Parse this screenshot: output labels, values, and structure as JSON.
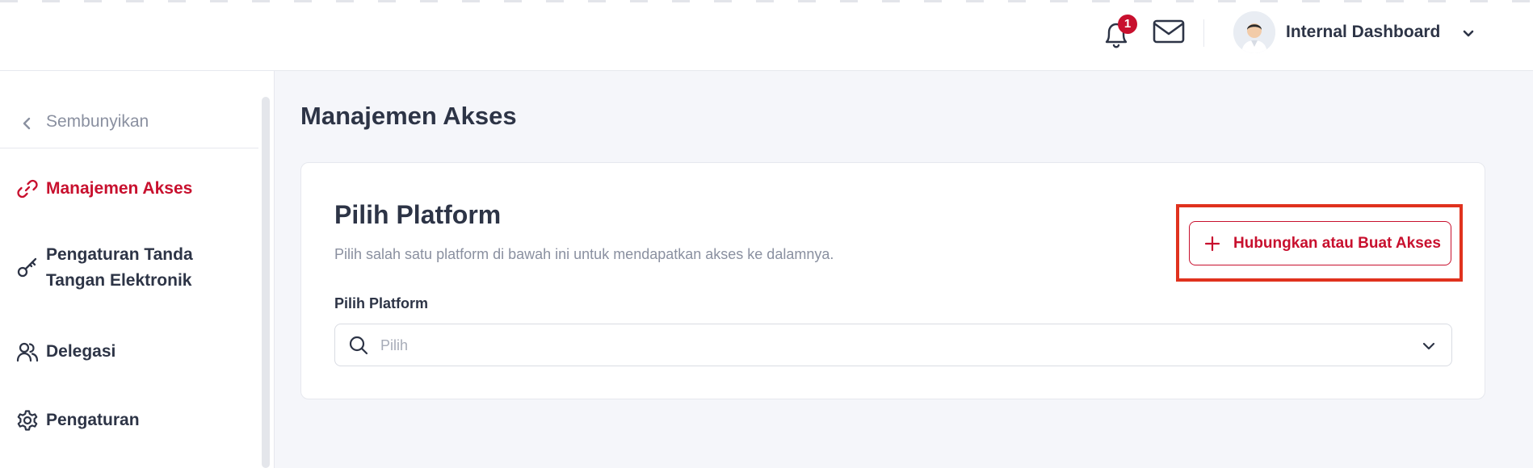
{
  "header": {
    "notification_count": "1",
    "profile_name": "Internal Dashboard",
    "icons": [
      "bell-icon",
      "mail-icon",
      "chevron-down-icon"
    ]
  },
  "sidebar": {
    "hide_label": "Sembunyikan",
    "items": [
      {
        "label": "Manajemen Akses",
        "icon": "link-icon",
        "active": true
      },
      {
        "label_line1": "Pengaturan Tanda",
        "label_line2": "Tangan Elektronik",
        "icon": "key-icon",
        "active": false
      },
      {
        "label": "Delegasi",
        "icon": "users-icon",
        "active": false
      },
      {
        "label": "Pengaturan",
        "icon": "gear-icon",
        "active": false
      }
    ]
  },
  "main": {
    "page_title": "Manajemen Akses",
    "card": {
      "title": "Pilih Platform",
      "subtitle": "Pilih salah satu platform di bawah ini untuk mendapatkan akses ke dalamnya.",
      "connect_button_label": "Hubungkan atau Buat Akses",
      "field_label": "Pilih Platform",
      "select_placeholder": "Pilih"
    }
  },
  "colors": {
    "accent": "#c8102e",
    "highlight": "#e0321e",
    "background": "#f5f6fa",
    "text": "#2d3446",
    "muted": "#8a90a0"
  }
}
